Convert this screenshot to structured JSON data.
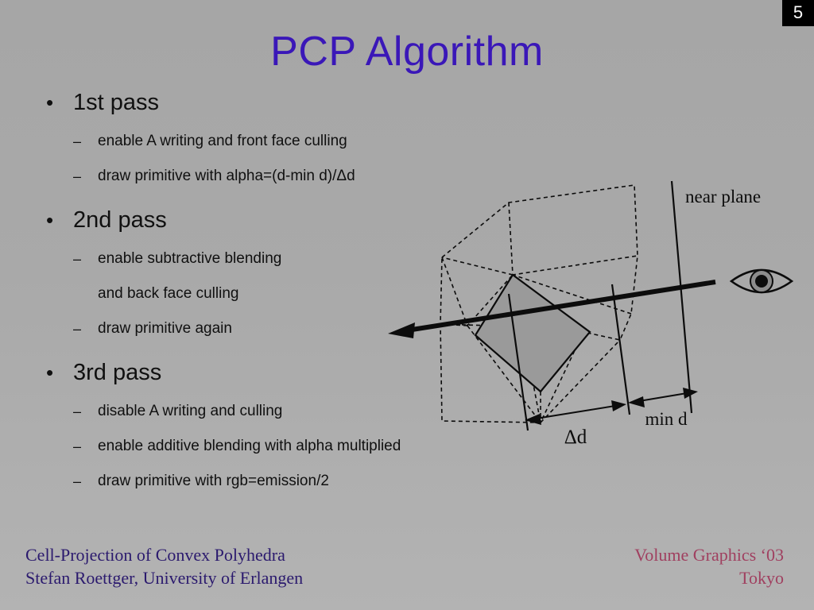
{
  "slide": {
    "number": "5",
    "title": "PCP Algorithm",
    "background_color": "#a9a9a9",
    "title_color": "#3a17b8"
  },
  "body": {
    "groups": [
      {
        "heading": "1st pass",
        "bullet_marker": "•",
        "items": [
          {
            "marker": "–",
            "text": "enable A writing and front face culling"
          },
          {
            "marker": "–",
            "text": "draw primitive with alpha=(d-min d)/Δd"
          }
        ]
      },
      {
        "heading": "2nd pass",
        "bullet_marker": "•",
        "items": [
          {
            "marker": "–",
            "text": "enable subtractive blending"
          },
          {
            "marker": "",
            "text": "and back face culling"
          },
          {
            "marker": "–",
            "text": "draw primitive again"
          }
        ]
      },
      {
        "heading": "3rd pass",
        "bullet_marker": "•",
        "items": [
          {
            "marker": "–",
            "text": "disable A writing and culling"
          },
          {
            "marker": "–",
            "text": "enable additive blending with alpha multiplied"
          },
          {
            "marker": "–",
            "text": "draw primitive with rgb=emission/2"
          }
        ]
      }
    ]
  },
  "footer": {
    "left_line1": "Cell-Projection of Convex Polyhedra",
    "left_line2": "Stefan Roettger, University of Erlangen",
    "left_color": "#2b1a6e",
    "right_line1": "Volume Graphics  ‘03",
    "right_line2": "Tokyo",
    "right_color": "#a04060"
  },
  "diagram": {
    "labels": {
      "near_plane": "near plane",
      "delta_d": "Δd",
      "min_d": "min d"
    },
    "colors": {
      "fill_gray": "#9a9a9a",
      "stroke": "#0c0c0c",
      "iris": "#8c8c8c",
      "pupil": "#0c0c0c"
    }
  }
}
